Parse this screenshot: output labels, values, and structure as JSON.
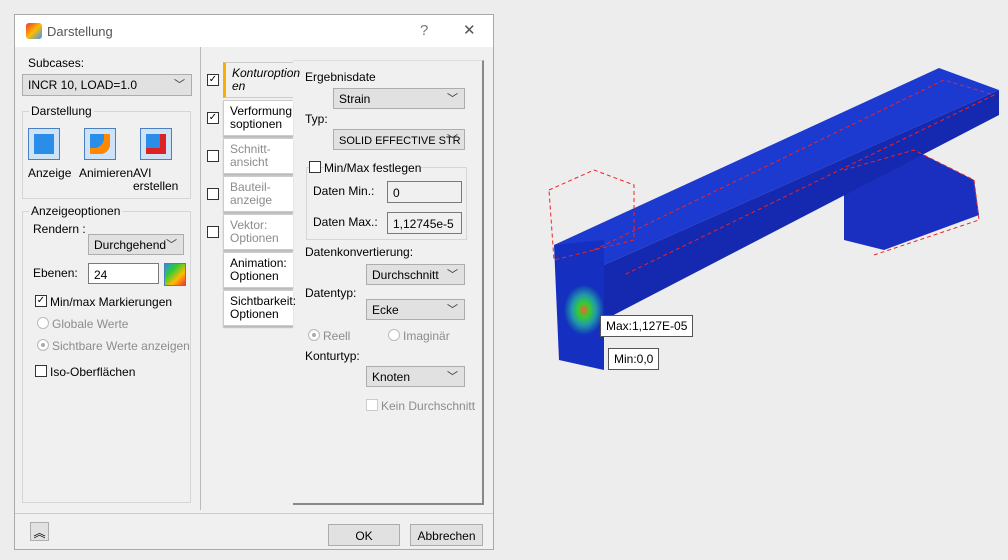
{
  "window": {
    "title": "Darstellung",
    "help": "?",
    "close": "✕"
  },
  "left": {
    "subcases_label": "Subcases:",
    "subcases_value": "INCR 10, LOAD=1.0",
    "darstellung_group": "Darstellung",
    "buttons": [
      {
        "label": "Anzeige"
      },
      {
        "label": "Animieren"
      },
      {
        "label": "AVI",
        "label2": "erstellen"
      }
    ],
    "anzeige_group": "Anzeigeoptionen",
    "rendern_label": "Rendern :",
    "rendern_value": "Durchgehend",
    "ebenen_label": "Ebenen:",
    "ebenen_value": "24",
    "minmax_label": "Min/max Markierungen",
    "minmax_checked": true,
    "globale_label": "Globale Werte",
    "sichtbare_label": "Sichtbare Werte anzeigen",
    "iso_label": "Iso-Oberflächen",
    "iso_checked": false
  },
  "tabs": [
    {
      "l1": "Konturoption",
      "l2": "en",
      "checked": true,
      "active": true
    },
    {
      "l1": "Verformung",
      "l2": "soptionen",
      "checked": true
    },
    {
      "l1": "Schnitt-",
      "l2": "ansicht",
      "checked": false,
      "disabled": true
    },
    {
      "l1": "Bauteil-",
      "l2": "anzeige",
      "checked": false,
      "disabled": true
    },
    {
      "l1": "Vektor:",
      "l2": "Optionen",
      "checked": false,
      "disabled": true
    },
    {
      "l1": "Animation:",
      "l2": "Optionen"
    },
    {
      "l1": "Sichtbarkeit:",
      "l2": "Optionen"
    }
  ],
  "panel": {
    "ergebnis_label": "Ergebnisdate",
    "ergebnis_value": "Strain",
    "typ_label": "Typ:",
    "typ_value": "SOLID EFFECTIVE STR",
    "minmax_fest_label": "Min/Max festlegen",
    "daten_min_label": "Daten Min.:",
    "daten_min_value": "0",
    "daten_max_label": "Daten Max.:",
    "daten_max_value": "1,12745e-5",
    "konv_label": "Datenkonvertierung:",
    "konv_value": "Durchschnitt",
    "datentyp_label": "Datentyp:",
    "datentyp_value": "Ecke",
    "reell_label": "Reell",
    "imag_label": "Imaginär",
    "konturtyp_label": "Konturtyp:",
    "konturtyp_value": "Knoten",
    "kein_label": "Kein Durchschnitt"
  },
  "footer": {
    "ok": "OK",
    "cancel": "Abbrechen",
    "expand_icon": "double-chevron-up"
  },
  "viewport": {
    "max_label": "Max:1,127E-05",
    "min_label": "Min:0,0"
  }
}
